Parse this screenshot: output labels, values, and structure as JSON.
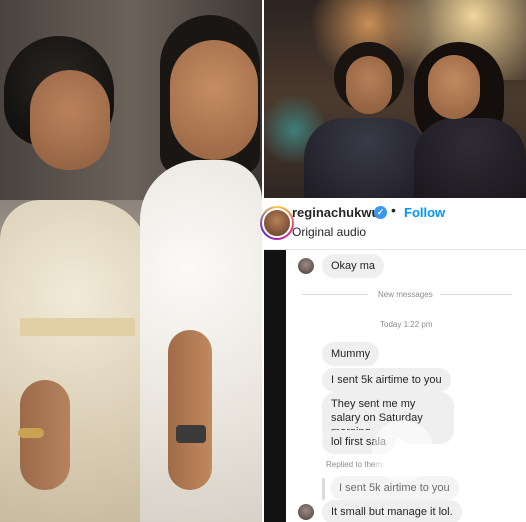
{
  "post": {
    "username": "reginachukwu",
    "verified_icon": "verified-badge-icon",
    "separator": "•",
    "follow_label": "Follow",
    "audio_label": "Original audio"
  },
  "chat": {
    "first_reply": "Okay ma",
    "new_messages_label": "New messages",
    "timestamp": "Today 1:22 pm",
    "messages": [
      "Mummy",
      "I sent 5k airtime to you",
      "They sent me my salary on Saturday morning.",
      "lol first sala"
    ],
    "replied_label": "Replied to them",
    "quoted_message": "I sent 5k airtime to you",
    "last_reply": "It small but manage it lol."
  },
  "colors": {
    "follow": "#0095f6",
    "verified": "#3897f0",
    "bubble": "#efefef"
  }
}
